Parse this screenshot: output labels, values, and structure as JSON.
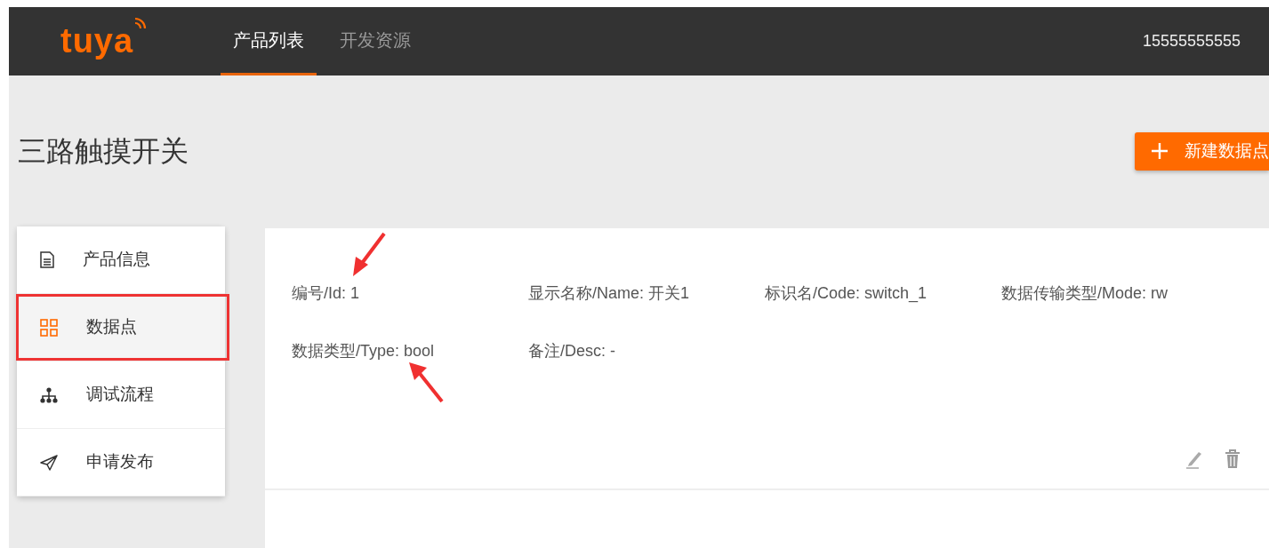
{
  "brand": {
    "logo": "tuya"
  },
  "nav": {
    "tabs": [
      {
        "label": "产品列表",
        "selected": true
      },
      {
        "label": "开发资源",
        "selected": false
      }
    ],
    "user": "15555555555"
  },
  "page": {
    "title": "三路触摸开关",
    "add_button": "新建数据点"
  },
  "sidebar": {
    "items": [
      {
        "label": "产品信息",
        "selected": false
      },
      {
        "label": "数据点",
        "selected": true
      },
      {
        "label": "调试流程",
        "selected": false
      },
      {
        "label": "申请发布",
        "selected": false
      }
    ]
  },
  "datapoints": [
    {
      "fields": [
        "编号/Id: 1",
        "显示名称/Name: 开关1",
        "标识名/Code: switch_1",
        "数据传输类型/Mode: rw",
        "数据类型/Type: bool",
        "备注/Desc: -"
      ]
    }
  ]
}
